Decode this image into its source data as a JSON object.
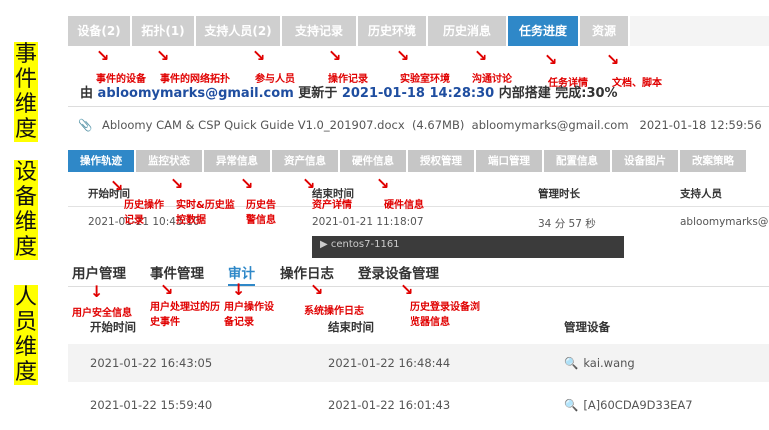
{
  "side_labels": {
    "event": "事件维度",
    "device": "设备维度",
    "person": "人员维度"
  },
  "event_panel": {
    "tabs": [
      "设备(2)",
      "拓扑(1)",
      "支持人员(2)",
      "支持记录",
      "历史环境",
      "历史消息",
      "任务进度",
      "资源"
    ],
    "active_tab": "任务进度",
    "annotations": [
      "事件的设备",
      "事件的网络拓扑",
      "参与人员",
      "操作记录",
      "实验室环境",
      "沟通讨论",
      "任务详情",
      "文档、脚本"
    ],
    "meta": {
      "prefix": "由",
      "email": "abloomymarks@gmail.com",
      "updated_label": "更新于",
      "datetime": "2021-01-18 14:28:30",
      "built": "内部搭建",
      "progress": "完成:30%"
    },
    "attachment": {
      "filename": "Abloomy CAM & CSP Quick Guide V1.0_201907.docx",
      "size": "(4.67MB)",
      "owner": "abloomymarks@gmail.com",
      "time": "2021-01-18 12:59:56"
    }
  },
  "device_panel": {
    "tabs": [
      "操作轨迹",
      "监控状态",
      "异常信息",
      "资产信息",
      "硬件信息",
      "授权管理",
      "端口管理",
      "配置信息",
      "设备图片",
      "改案策略"
    ],
    "active_tab": "操作轨迹",
    "headers": [
      "开始时间",
      "结束时间",
      "管理时长",
      "支持人员"
    ],
    "row": [
      "2021-01-21 10:43:10",
      "2021-01-21 11:18:07",
      "34 分 57 秒",
      "abloomymarks@g"
    ],
    "annotations": [
      "历史操作记录",
      "实时&历史监控数据",
      "历史告警信息",
      "资产详情",
      "硬件信息"
    ],
    "overlay": "centos7-1161"
  },
  "person_panel": {
    "tabs": [
      "用户管理",
      "事件管理",
      "审计",
      "操作日志",
      "登录设备管理"
    ],
    "active_tab": "审计",
    "annotations": [
      "用户安全信息",
      "用户处理过的历史事件",
      "用户操作设备记录",
      "系统操作日志",
      "历史登录设备浏览器信息"
    ],
    "headers": [
      "开始时间",
      "结束时间",
      "管理设备"
    ],
    "rows": [
      [
        "2021-01-22 16:43:05",
        "2021-01-22 16:48:44",
        "kai.wang"
      ],
      [
        "2021-01-22 15:59:40",
        "2021-01-22 16:01:43",
        "[A]60CDA9D33EA7"
      ]
    ]
  }
}
